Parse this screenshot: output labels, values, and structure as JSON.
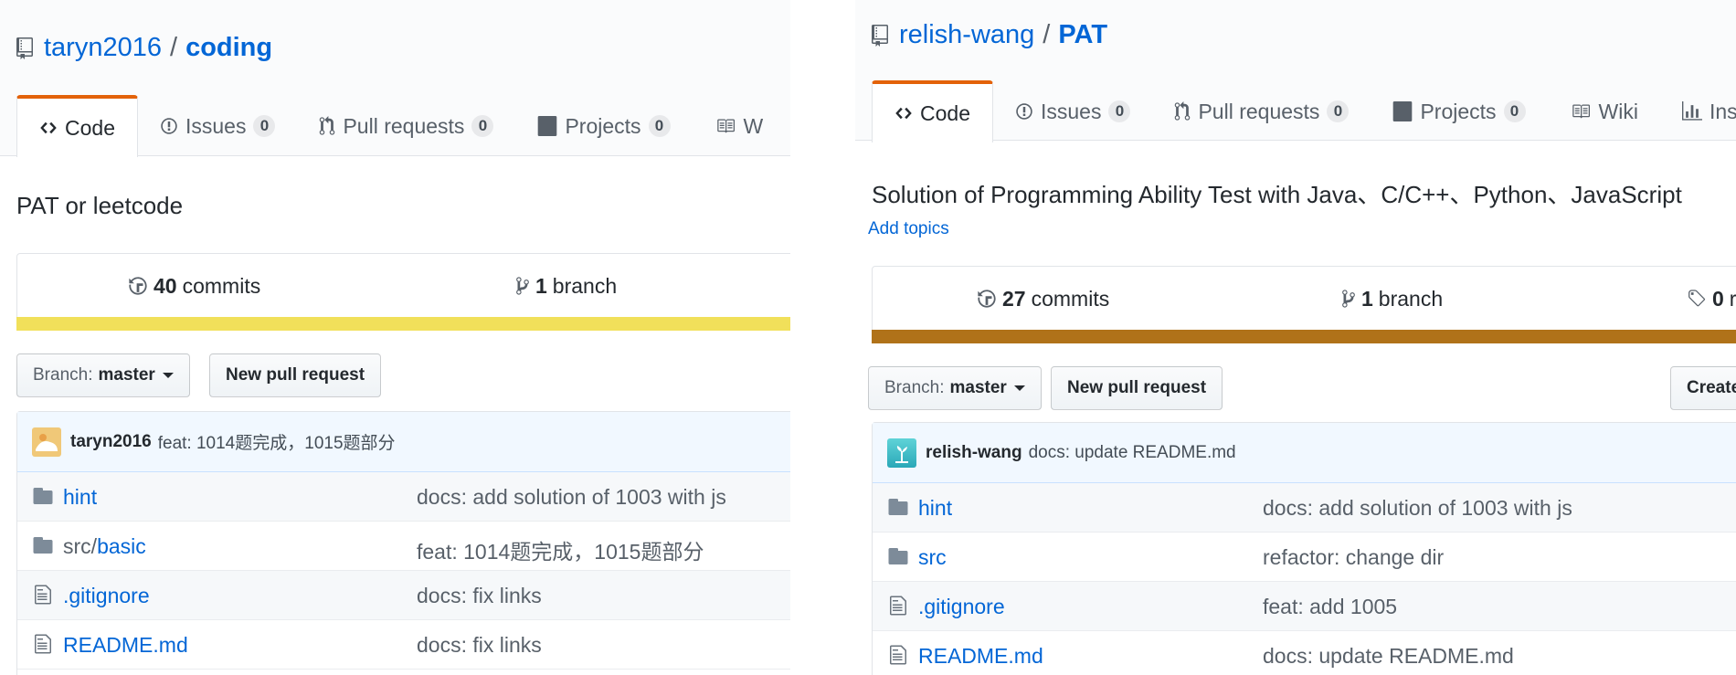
{
  "left": {
    "owner": "taryn2016",
    "separator": "/",
    "repo": "coding",
    "tabs": [
      {
        "label": "Code"
      },
      {
        "label": "Issues",
        "count": "0"
      },
      {
        "label": "Pull requests",
        "count": "0"
      },
      {
        "label": "Projects",
        "count": "0"
      },
      {
        "label": "W"
      }
    ],
    "description": "PAT or leetcode",
    "summary": {
      "commits_count": "40",
      "commits_label": "commits",
      "branch_count": "1",
      "branch_label": "branch",
      "language_color": "#f1e05a"
    },
    "branch_button": {
      "prefix": "Branch:",
      "value": "master"
    },
    "new_pr_button": "New pull request",
    "latest_commit": {
      "author": "taryn2016",
      "message": "feat: 1014题完成，1015题部分"
    },
    "files": [
      {
        "type": "folder",
        "name": "hint",
        "commit": "docs: add solution of 1003 with js"
      },
      {
        "type": "folder",
        "path": "src/",
        "name": "basic",
        "commit": "feat: 1014题完成，1015题部分"
      },
      {
        "type": "file",
        "name": ".gitignore",
        "commit": "docs: fix links"
      },
      {
        "type": "file",
        "name": "README.md",
        "commit": "docs: fix links"
      }
    ]
  },
  "right": {
    "owner": "relish-wang",
    "separator": "/",
    "repo": "PAT",
    "tabs": [
      {
        "label": "Code"
      },
      {
        "label": "Issues",
        "count": "0"
      },
      {
        "label": "Pull requests",
        "count": "0"
      },
      {
        "label": "Projects",
        "count": "0"
      },
      {
        "label": "Wiki"
      },
      {
        "label": "Ins"
      }
    ],
    "description": "Solution of Programming Ability Test with Java、C/C++、Python、JavaScript",
    "add_topics": "Add topics",
    "summary": {
      "commits_count": "27",
      "commits_label": "commits",
      "branch_count": "1",
      "branch_label": "branch",
      "releases_count": "0",
      "releases_label": "re",
      "language_color": "#b07219"
    },
    "branch_button": {
      "prefix": "Branch:",
      "value": "master"
    },
    "new_pr_button": "New pull request",
    "create_button": "Create",
    "latest_commit": {
      "author": "relish-wang",
      "message": "docs: update README.md"
    },
    "files": [
      {
        "type": "folder",
        "name": "hint",
        "commit": "docs: add solution of 1003 with js"
      },
      {
        "type": "folder",
        "name": "src",
        "commit": "refactor: change dir"
      },
      {
        "type": "file",
        "name": ".gitignore",
        "commit": "feat: add 1005"
      },
      {
        "type": "file",
        "name": "README.md",
        "commit": "docs: update README.md"
      }
    ]
  }
}
